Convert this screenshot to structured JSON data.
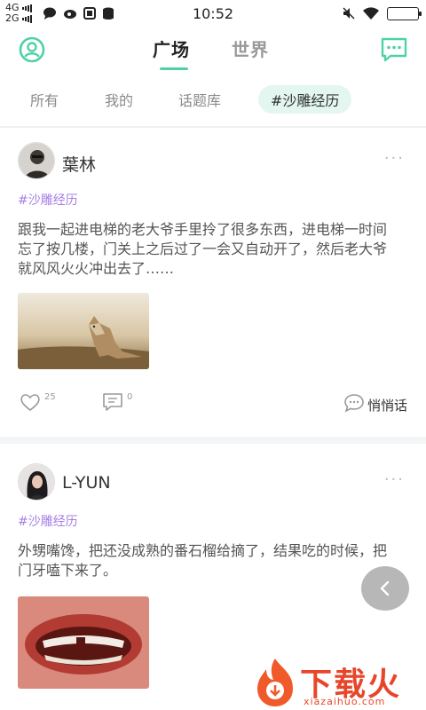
{
  "status_bar": {
    "network_top": "4G",
    "network_bottom": "2G",
    "time": "10:52"
  },
  "header": {
    "tabs": [
      {
        "label": "广场",
        "active": true
      },
      {
        "label": "世界",
        "active": false
      }
    ],
    "accent_color": "#4fd1a8"
  },
  "subtabs": [
    "所有",
    "我的",
    "话题库",
    "#沙雕经历"
  ],
  "posts": [
    {
      "username": "葉林",
      "topic": "#沙雕经历",
      "content": "跟我一起进电梯的老大爷手里拎了很多东西，进电梯一时间忘了按几楼，门关上之后过了一会又自动开了，然后老大爷就风风火火冲出去了……",
      "likes": "25",
      "comments": "0",
      "whisper_label": "悄悄话"
    },
    {
      "username": "L-YUN",
      "topic": "#沙雕经历",
      "content": "外甥嘴馋，把还没成熟的番石榴给摘了，结果吃的时候，把门牙嗑下来了。"
    }
  ],
  "watermark": {
    "brand": "下载火",
    "url": "xiazaihuo.com"
  }
}
